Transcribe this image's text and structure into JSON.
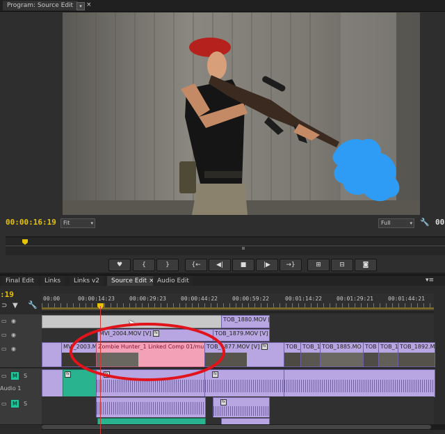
{
  "program_monitor": {
    "tab_title": "Program: Source Edit",
    "timecode_current": "00:00:16:19",
    "timecode_end": "00",
    "zoom": "Fit",
    "quality": "Full"
  },
  "transport": {
    "buttons": [
      "marker",
      "in",
      "out",
      "go-to-in",
      "step-back",
      "stop",
      "play",
      "go-to-out",
      "lift",
      "extract",
      "export-frame"
    ]
  },
  "timeline_tabs": [
    "Final Edit",
    "Links",
    "Links v2",
    "Source Edit",
    "Audio Edit"
  ],
  "timeline": {
    "timecode_partial": ":19",
    "ruler_labels": [
      "00:00",
      "00:00:14:23",
      "00:00:29:23",
      "00:00:44:22",
      "00:00:59:22",
      "00:01:14:22",
      "00:01:29:21",
      "00:01:44:21"
    ],
    "clips": {
      "v3_right": "TOB_1880.MOV [",
      "v2_left": "MVI_2004.MOV [V]",
      "v2_right": "TOB_1879.MOV [V]",
      "v1_a": "MVI_2003.M",
      "v1_b": "Zombie Hunter_1 Linked Comp 01/mu",
      "v1_c": "TOB_1877.MOV [V]",
      "v1_d": "TOB_",
      "v1_e": "TOB_1",
      "v1_f": "TOB_1885.MO",
      "v1_g": "TOB",
      "v1_h": "TOB_1",
      "v1_i": "TOB_1892.M"
    },
    "audio_track_name": "Audio 1",
    "track_buttons": {
      "mute": "M",
      "solo": "S"
    }
  },
  "colors": {
    "timecode": "#e6c200",
    "video_clip": "#b7a6e2",
    "audio_clip": "#29b48f",
    "linked_comp": "#f2a1b6",
    "annotation_ring": "#e0141a",
    "smoke": "#2e9cf5"
  }
}
